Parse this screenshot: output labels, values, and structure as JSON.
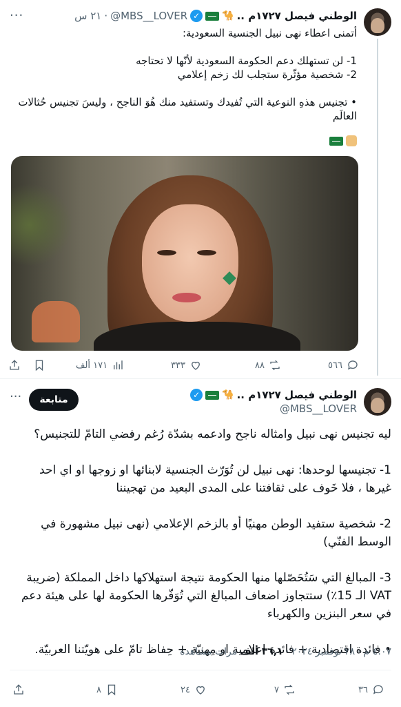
{
  "tweet1": {
    "name": "الوطني فيصل ١٧٢٧م ..",
    "handle": "@MBS__LOVER",
    "time": "٢١ س",
    "separator": "·",
    "more": "···",
    "lines": [
      "أتمنى اعطاء نهى نبيل الجنسية السعودية:",
      "",
      "1- لن تستهلك دعم الحكومة السعودية لأنّها لا تحتاجه",
      "2- شخصية مؤثّرة ستجلب لك زخم إعلامي",
      "",
      "• تجنيس هذهِ النوعية التي تُفيدك وتستفيد منك هُوَ الناجح ، وليسَ تجنيس حُثالات العالَم"
    ],
    "stats": {
      "replies": "٥٦٦",
      "reposts": "٨٨",
      "likes": "٣٣٣",
      "views": "١٧١ ألف"
    }
  },
  "tweet2": {
    "name": "الوطني فيصل ١٧٢٧م ..",
    "handle": "@MBS__LOVER",
    "follow_label": "متابعة",
    "more": "···",
    "paragraphs": [
      "ليه تجنيس نهى نبيل وامثاله ناجح وادعمه بشدّة رُغم رفضي التامّ للتجنيس؟",
      "1- تجنيسها لوحدها: نهى نبيل لن تُوَرّث الجنسية لابنائها او زوجها او اي احد غيرها ، فلا خَوف على ثقافتنا على المدى البعيد من تهجيننا",
      "2- شخصية ستفيد الوطن مهنيًا أو بالزخم الإعلامي (نهى نبيل مشهورة في الوسط الفنّي)",
      "3- المبالغ التي سَتُحَصّلها منها الحكومة نتيجة استهلاكها داخل المملكة (ضريبة VAT الـ 15٪) ستتجاوز اضعاف المبالغ التي تُوَفّرها الحكومة لها على هيئة دعم في سعر البنزين والكهرباء",
      "• فائدة اقتصادية + فائدة اعلامية او مِهنيّة + حِفاظ تامّ على هويّتنا العربيّة."
    ],
    "meta": {
      "time": "٤:٠٧ م",
      "date": "٢٨ نوفمبر ٢٠٢٤",
      "views_count": "٣٦,١ ألف",
      "views_label": "مرات مشاهدة",
      "separator": "·"
    },
    "stats": {
      "replies": "٣٦",
      "reposts": "٧",
      "likes": "٢٤",
      "bookmarks": "٨"
    }
  },
  "colors": {
    "accent": "#1d9bf0",
    "text": "#0f1419",
    "muted": "#536471"
  }
}
